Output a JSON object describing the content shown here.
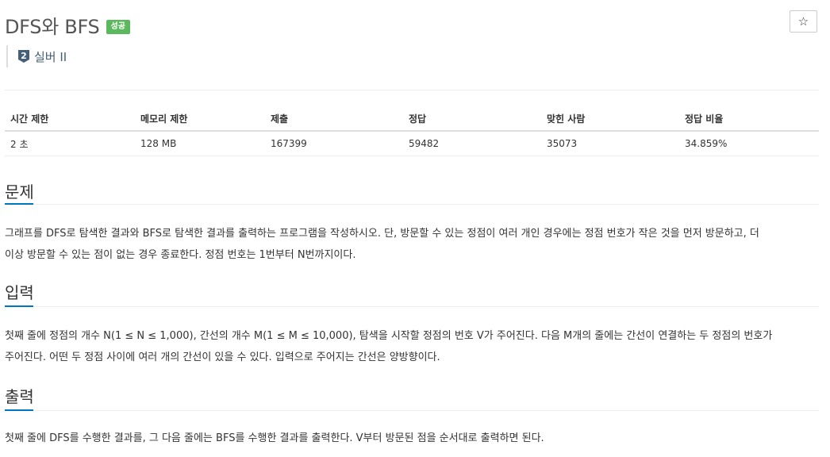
{
  "problem": {
    "title": "DFS와 BFS",
    "status_badge": "성공",
    "tier": {
      "number": "2",
      "label": "실버 II"
    },
    "star_icon": "star-outline-icon"
  },
  "colors": {
    "badge": "#5cb85c",
    "tier": "#435f7a",
    "section_underline": "#0076c0"
  },
  "info_table": {
    "headers": [
      "시간 제한",
      "메모리 제한",
      "제출",
      "정답",
      "맞힌 사람",
      "정답 비율"
    ],
    "values": [
      "2 초",
      "128 MB",
      "167399",
      "59482",
      "35073",
      "34.859%"
    ]
  },
  "sections": {
    "description": {
      "title": "문제",
      "line1": "그래프를 DFS로 탐색한 결과와 BFS로 탐색한 결과를 출력하는 프로그램을 작성하시오. 단, 방문할 수 있는 정점이 여러 개인 경우에는 정점 번호가 작은 것을 먼저 방문하고, 더",
      "line2": "이상 방문할 수 있는 점이 없는 경우 종료한다. 정점 번호는 1번부터 N번까지이다."
    },
    "input": {
      "title": "입력",
      "line1": "첫째 줄에 정점의 개수 N(1 ≤ N ≤ 1,000), 간선의 개수 M(1 ≤ M ≤ 10,000), 탐색을 시작할 정점의 번호 V가 주어진다. 다음 M개의 줄에는 간선이 연결하는 두 정점의 번호가",
      "line2": "주어진다. 어떤 두 정점 사이에 여러 개의 간선이 있을 수 있다. 입력으로 주어지는 간선은 양방향이다."
    },
    "output": {
      "title": "출력",
      "line1": "첫째 줄에 DFS를 수행한 결과를, 그 다음 줄에는 BFS를 수행한 결과를 출력한다. V부터 방문된 점을 순서대로 출력하면 된다."
    }
  }
}
